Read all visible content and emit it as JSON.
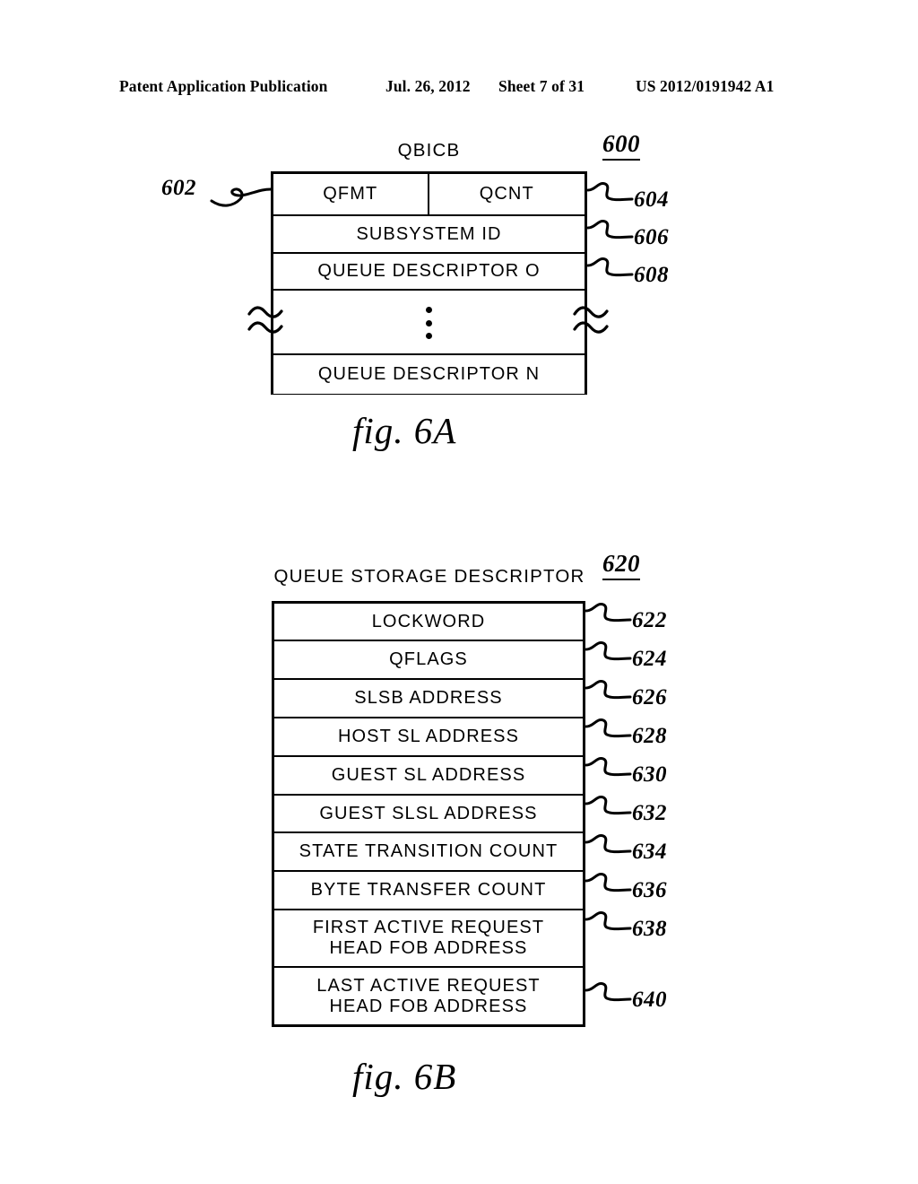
{
  "header": {
    "publication": "Patent Application Publication",
    "date": "Jul. 26, 2012",
    "sheet": "Sheet 7 of 31",
    "patent_number": "US 2012/0191942 A1"
  },
  "figures": [
    {
      "id": "fig-6a",
      "caption": "fig.  6A",
      "figure_number": "600",
      "box_title": "QBICB",
      "left_ref": "602",
      "rows": [
        {
          "type": "split",
          "cells": [
            "QFMT",
            "QCNT"
          ],
          "ref": "604"
        },
        {
          "type": "single",
          "text": "SUBSYSTEM ID",
          "ref": "606"
        },
        {
          "type": "single",
          "text": "QUEUE DESCRIPTOR O",
          "ref": "608"
        },
        {
          "type": "ellipsis",
          "text": "",
          "ref": ""
        },
        {
          "type": "single",
          "text": "QUEUE DESCRIPTOR N",
          "ref": ""
        }
      ]
    },
    {
      "id": "fig-6b",
      "caption": "fig.  6B",
      "figure_number": "620",
      "box_title": "QUEUE STORAGE DESCRIPTOR",
      "rows": [
        {
          "type": "single",
          "text": "LOCKWORD",
          "ref": "622"
        },
        {
          "type": "single",
          "text": "QFLAGS",
          "ref": "624"
        },
        {
          "type": "single",
          "text": "SLSB ADDRESS",
          "ref": "626"
        },
        {
          "type": "single",
          "text": "HOST SL ADDRESS",
          "ref": "628"
        },
        {
          "type": "single",
          "text": "GUEST SL ADDRESS",
          "ref": "630"
        },
        {
          "type": "single",
          "text": "GUEST SLSL ADDRESS",
          "ref": "632"
        },
        {
          "type": "single",
          "text": "STATE TRANSITION COUNT",
          "ref": "634"
        },
        {
          "type": "single",
          "text": "BYTE TRANSFER COUNT",
          "ref": "636"
        },
        {
          "type": "two-line",
          "line1": "FIRST ACTIVE REQUEST",
          "line2": "HEAD FOB ADDRESS",
          "ref": "638"
        },
        {
          "type": "two-line",
          "line1": "LAST ACTIVE REQUEST",
          "line2": "HEAD FOB ADDRESS",
          "ref": "640"
        }
      ]
    }
  ],
  "colors": {
    "ink": "#000000",
    "paper": "#ffffff"
  }
}
